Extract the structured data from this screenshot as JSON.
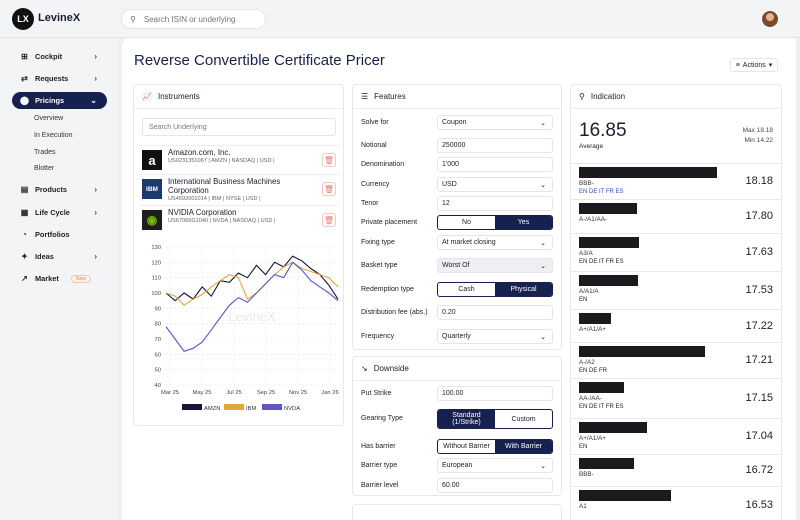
{
  "app": {
    "logo_text": "LX",
    "name": "LevineX"
  },
  "search": {
    "placeholder": "Search ISIN or underlying"
  },
  "sidebar": {
    "items": [
      {
        "label": "Cockpit",
        "icon": "cockpit-icon",
        "chevron": "›"
      },
      {
        "label": "Requests",
        "icon": "requests-icon",
        "chevron": "›"
      },
      {
        "label": "Pricings",
        "icon": "pricings-icon",
        "chevron": "⌄"
      },
      {
        "label": "Products",
        "icon": "products-icon",
        "chevron": "›"
      },
      {
        "label": "Life Cycle",
        "icon": "calendar-icon",
        "chevron": "›"
      },
      {
        "label": "Portfolios",
        "icon": "portfolios-icon",
        "chevron": ""
      },
      {
        "label": "Ideas",
        "icon": "ideas-icon",
        "chevron": "›"
      },
      {
        "label": "Market",
        "icon": "market-icon",
        "chevron": "",
        "badge": "New"
      }
    ],
    "subitems": [
      "Overview",
      "In Execution",
      "Trades",
      "Blotter"
    ]
  },
  "page": {
    "title": "Reverse Convertible Certificate Pricer",
    "actions_label": "Actions"
  },
  "instruments": {
    "title": "Instruments",
    "search_placeholder": "Search Underlying",
    "items": [
      {
        "name": "Amazon.com, Inc.",
        "meta": "US0231351067 | AMZN | NASDAQ | USD |",
        "logo": "a"
      },
      {
        "name": "International Business Machines Corporation",
        "meta": "US4592001014 | IBM | NYSE | USD |",
        "logo": "IBM"
      },
      {
        "name": "NVIDIA Corporation",
        "meta": "US67066G1040 | NVDA | NASDAQ | USD |",
        "logo": "◉"
      }
    ]
  },
  "chart_data": {
    "type": "line",
    "x": [
      "Mar 25",
      "May 25",
      "Jul 25",
      "Sep 25",
      "Nov 25",
      "Jan 26"
    ],
    "ylim": [
      40,
      130
    ],
    "yticks": [
      40,
      50,
      60,
      70,
      80,
      90,
      100,
      110,
      120,
      130
    ],
    "watermark": "LevineX",
    "legend_position": "bottom",
    "series": [
      {
        "name": "AMZN",
        "color": "#151638",
        "values": [
          100,
          95,
          100,
          96,
          104,
          98,
          108,
          107,
          113,
          110,
          118,
          112,
          120,
          117,
          124,
          121,
          116,
          112,
          105,
          96
        ]
      },
      {
        "name": "IBM",
        "color": "#e0a83a",
        "values": [
          100,
          98,
          92,
          96,
          99,
          104,
          108,
          112,
          110,
          96,
          100,
          106,
          112,
          117,
          120,
          116,
          114,
          112,
          110,
          104
        ]
      },
      {
        "name": "NVDA",
        "color": "#5b56c2",
        "values": [
          78,
          70,
          62,
          64,
          68,
          76,
          84,
          92,
          97,
          94,
          100,
          106,
          112,
          110,
          120,
          115,
          108,
          104,
          100,
          95
        ]
      }
    ]
  },
  "features": {
    "title": "Features",
    "fields": [
      {
        "label": "Solve for",
        "value": "Coupon",
        "type": "select"
      },
      {
        "label": "Notional",
        "value": "250000",
        "type": "input"
      },
      {
        "label": "Denomination",
        "value": "1'000",
        "type": "input"
      },
      {
        "label": "Currency",
        "value": "USD",
        "type": "select"
      },
      {
        "label": "Tenor",
        "value": "12",
        "type": "input"
      },
      {
        "label": "Private placement",
        "options": [
          "No",
          "Yes"
        ],
        "selected": 1,
        "type": "toggle"
      },
      {
        "label": "Fixing type",
        "value": "At market closing",
        "type": "select"
      },
      {
        "label": "Basket type",
        "value": "Worst Of",
        "type": "select-gray"
      },
      {
        "label": "Redemption type",
        "options": [
          "Cash",
          "Physical"
        ],
        "selected": 1,
        "type": "toggle"
      },
      {
        "label": "Distribution fee (abs.)",
        "value": "0.20",
        "type": "input"
      },
      {
        "label": "Frequency",
        "value": "Quarterly",
        "type": "select"
      }
    ]
  },
  "downside": {
    "title": "Downside",
    "fields": [
      {
        "label": "Put Strike",
        "value": "100.00",
        "type": "input"
      },
      {
        "label": "Gearing Type",
        "options": [
          "Standard (1/Strike)",
          "Custom"
        ],
        "selected": 0,
        "type": "toggle-tall"
      },
      {
        "label": "Has barrier",
        "options": [
          "Without Barrier",
          "With Barrier"
        ],
        "selected": 1,
        "type": "toggle"
      },
      {
        "label": "Barrier type",
        "value": "European",
        "type": "select"
      },
      {
        "label": "Barrier level",
        "value": "60.00",
        "type": "input"
      }
    ]
  },
  "indication": {
    "title": "Indication",
    "value": "16.85",
    "avg_label": "Average",
    "max_label": "Max 18.18",
    "min_label": "Min 14.22",
    "quotes": [
      {
        "rating": "BBB-",
        "langs": "EN DE IT FR ES",
        "value": "18.18",
        "blue": true
      },
      {
        "rating": "A-/A1/AA-",
        "langs": "",
        "value": "17.80"
      },
      {
        "rating": "A3/A",
        "langs": "EN DE IT FR ES",
        "value": "17.63"
      },
      {
        "rating": "A/A1/A",
        "langs": "EN",
        "value": "17.53"
      },
      {
        "rating": "A+/A1/A+",
        "langs": "",
        "value": "17.22"
      },
      {
        "rating": "A-/A2",
        "langs": "EN DE FR",
        "value": "17.21"
      },
      {
        "rating": "AA-/AA-",
        "langs": "EN DE IT FR ES",
        "value": "17.15"
      },
      {
        "rating": "A+/A1/A+",
        "langs": "EN",
        "value": "17.04"
      },
      {
        "rating": "BBB-",
        "langs": "",
        "value": "16.72"
      },
      {
        "rating": "A1",
        "langs": "",
        "value": "16.53"
      }
    ]
  }
}
